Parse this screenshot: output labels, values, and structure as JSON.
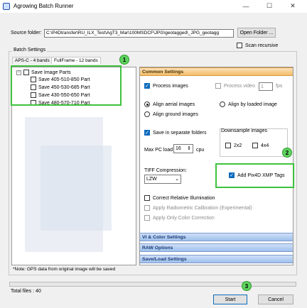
{
  "window": {
    "title": "Agrowing Batch Runner",
    "minimize": "—",
    "maximize": "☐",
    "close": "✕"
  },
  "source": {
    "label": "Source folder:",
    "path": "C:\\P4Dtransfer\\RU_ILX_Test\\AgT3_Mar\\100MSDCF\\JPG\\geotagged\\_JPG_geotagg",
    "open_button": "Open Folder ...",
    "scan_recursive": "Scan recursive"
  },
  "batch": {
    "title": "Batch Settings",
    "tabs": [
      "APS-C - 4 bands",
      "FullFrame - 12 bands"
    ],
    "tree": {
      "root": "Save Image Parts",
      "items": [
        "Save 405-510-850 Part",
        "Save 450-530-685 Part",
        "Save 430-550-650 Part",
        "Save 480-570-710 Part"
      ]
    }
  },
  "common": {
    "header": "Common Settings",
    "process_images": "Process images",
    "process_video": "Process video",
    "fps_value": "1",
    "fps_label": "fps",
    "align_aerial": "Align aerial images",
    "align_loaded": "Align by loaded image",
    "align_ground": "Align ground images",
    "save_separate": "Save in separate folders",
    "max_pc_label": "Max PC load:",
    "max_pc_value": "16",
    "cpu_label": "cpu",
    "downsample_title": "Downsample images",
    "downsample_2x2": "2x2",
    "downsample_4x4": "4x4",
    "tiff_title": "TIFF Compression:",
    "tiff_value": "LZW",
    "pix4d": "Add Pix4D XMP Tags",
    "correct_illum": "Correct Relative Illumination",
    "radiometric": "Apply Radiometric Calibration (Experimental)",
    "color_correction": "Apply Only Color Correction"
  },
  "sections": [
    "VI & Color Settings",
    "RAW Options",
    "Save/Load Settings"
  ],
  "note": "*Note: GPS data from original image will be saved",
  "footer": {
    "total_files": "Total files : 40",
    "start": "Start",
    "cancel": "Cancel"
  },
  "badges": [
    "1",
    "2",
    "3"
  ],
  "colors": {
    "highlight_green": "#3ec23e",
    "accent_blue": "#0f6cbd",
    "section_orange": "#f3bc6a"
  }
}
